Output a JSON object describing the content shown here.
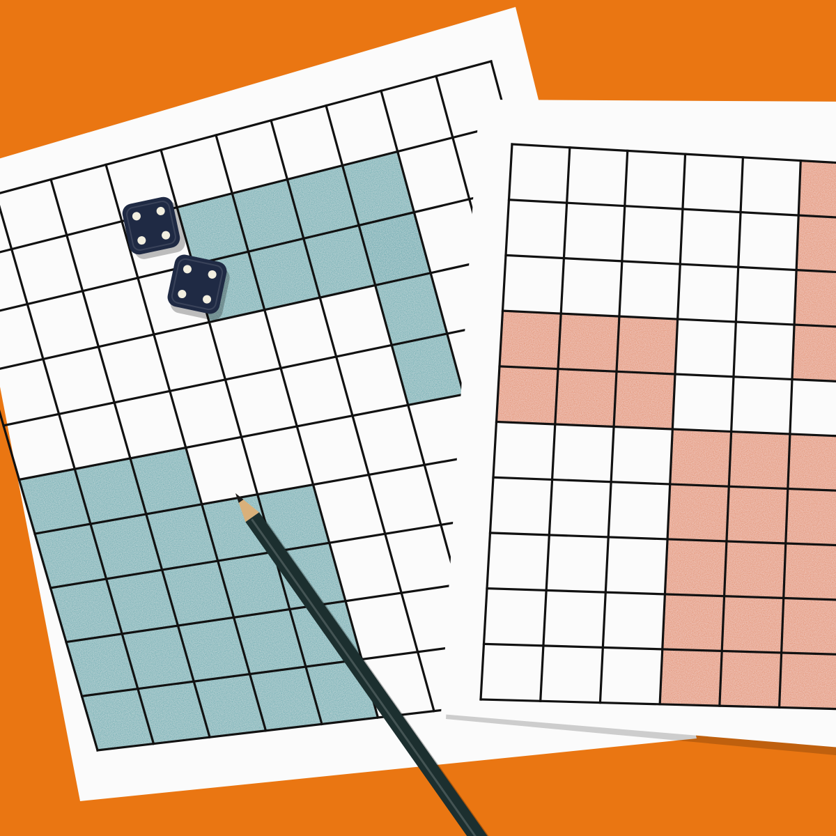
{
  "scene": {
    "background_color": "#ea7612",
    "paper_color": "#fbfbfb",
    "grid_line_color": "#111111"
  },
  "left_sheet": {
    "grid": {
      "rows": 10,
      "cols": 10
    },
    "fill_color": "#3f9ea5",
    "shaded_regions": [
      {
        "row": 1,
        "col": 4,
        "rows": 1,
        "cols": 4
      },
      {
        "row": 2,
        "col": 4,
        "rows": 1,
        "cols": 4
      },
      {
        "row": 2,
        "col": 7,
        "rows": 3,
        "cols": 1
      },
      {
        "row": 5,
        "col": 0,
        "rows": 1,
        "cols": 3
      },
      {
        "row": 6,
        "col": 0,
        "rows": 4,
        "cols": 5
      }
    ]
  },
  "right_sheet": {
    "grid": {
      "rows": 10,
      "cols": 7
    },
    "fill_color": "#e07a45",
    "shaded_regions": [
      {
        "row": 0,
        "col": 5,
        "rows": 4,
        "cols": 2
      },
      {
        "row": 3,
        "col": 0,
        "rows": 2,
        "cols": 3
      },
      {
        "row": 5,
        "col": 3,
        "rows": 5,
        "cols": 4
      }
    ]
  },
  "dice": [
    {
      "face": 4,
      "color": "#1f2a44",
      "pip_color": "#f2efe0"
    },
    {
      "face": 4,
      "color": "#1f2a44",
      "pip_color": "#f2efe0"
    }
  ],
  "pencil": {
    "body_color": "#1c2f2f",
    "wood_color": "#d9b07a",
    "lead_color": "#1a1a1a"
  }
}
